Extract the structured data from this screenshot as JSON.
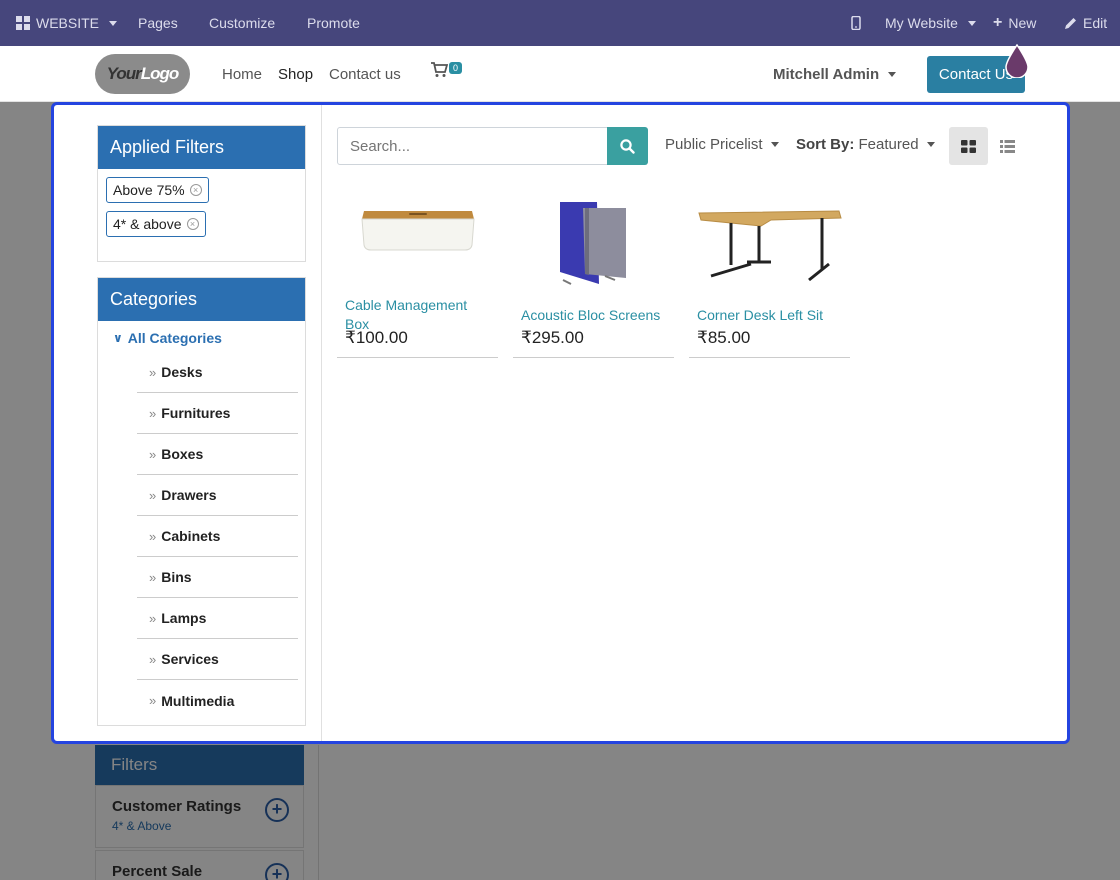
{
  "topbar": {
    "website_label": "WEBSITE",
    "pages": "Pages",
    "customize": "Customize",
    "promote": "Promote",
    "my_website": "My Website",
    "new": "New",
    "edit": "Edit"
  },
  "header": {
    "logo_your": "Your",
    "logo_logo": "Logo",
    "nav": [
      "Home",
      "Shop",
      "Contact us"
    ],
    "cart_count": "0",
    "user": "Mitchell Admin",
    "contact_btn": "Contact Us"
  },
  "applied_filters": {
    "title": "Applied Filters",
    "chips": [
      "Above 75%",
      "4* & above"
    ]
  },
  "categories": {
    "title": "Categories",
    "all": "All Categories",
    "items": [
      "Desks",
      "Furnitures",
      "Boxes",
      "Drawers",
      "Cabinets",
      "Bins",
      "Lamps",
      "Services",
      "Multimedia"
    ]
  },
  "toolbar": {
    "search_placeholder": "Search...",
    "pricelist": "Public Pricelist",
    "sort_label": "Sort By:",
    "sort_value": "Featured"
  },
  "products": [
    {
      "name": "Cable Management Box",
      "price": "₹100.00"
    },
    {
      "name": "Acoustic Bloc Screens",
      "price": "₹295.00"
    },
    {
      "name": "Corner Desk Left Sit",
      "price": "₹85.00"
    }
  ],
  "background_filters": {
    "title": "Filters",
    "customer_ratings": "Customer Ratings",
    "customer_ratings_sub": "4* & Above",
    "percent_sale": "Percent Sale"
  },
  "colors": {
    "topbar": "#46467c",
    "panel_header": "#2b6fb1",
    "modal_border": "#2444e0",
    "search_button": "#3aa0a0",
    "product_link": "#2a8fa3"
  }
}
